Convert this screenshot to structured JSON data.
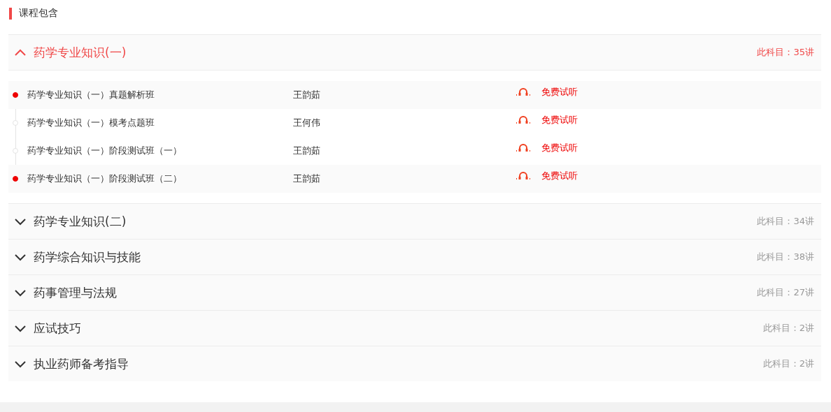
{
  "heading": "课程包含",
  "subjects": [
    {
      "name": "药学专业知识(一)",
      "count": "此科目：35讲",
      "expanded": true,
      "lessons": [
        {
          "title": "药学专业知识（一）真题解析班",
          "teacher": "王韵茹",
          "action": "免费试听",
          "highlighted": true
        },
        {
          "title": "药学专业知识（一）模考点题班",
          "teacher": "王何伟",
          "action": "免费试听",
          "highlighted": false
        },
        {
          "title": "药学专业知识（一）阶段测试班（一）",
          "teacher": "王韵茹",
          "action": "免费试听",
          "highlighted": false
        },
        {
          "title": "药学专业知识（一）阶段测试班（二）",
          "teacher": "王韵茹",
          "action": "免费试听",
          "highlighted": true
        }
      ]
    },
    {
      "name": "药学专业知识(二)",
      "count": "此科目：34讲",
      "expanded": false
    },
    {
      "name": "药学综合知识与技能",
      "count": "此科目：38讲",
      "expanded": false
    },
    {
      "name": "药事管理与法规",
      "count": "此科目：27讲",
      "expanded": false
    },
    {
      "name": "应试技巧",
      "count": "此科目：2讲",
      "expanded": false
    },
    {
      "name": "执业药师备考指导",
      "count": "此科目：2讲",
      "expanded": false
    }
  ]
}
